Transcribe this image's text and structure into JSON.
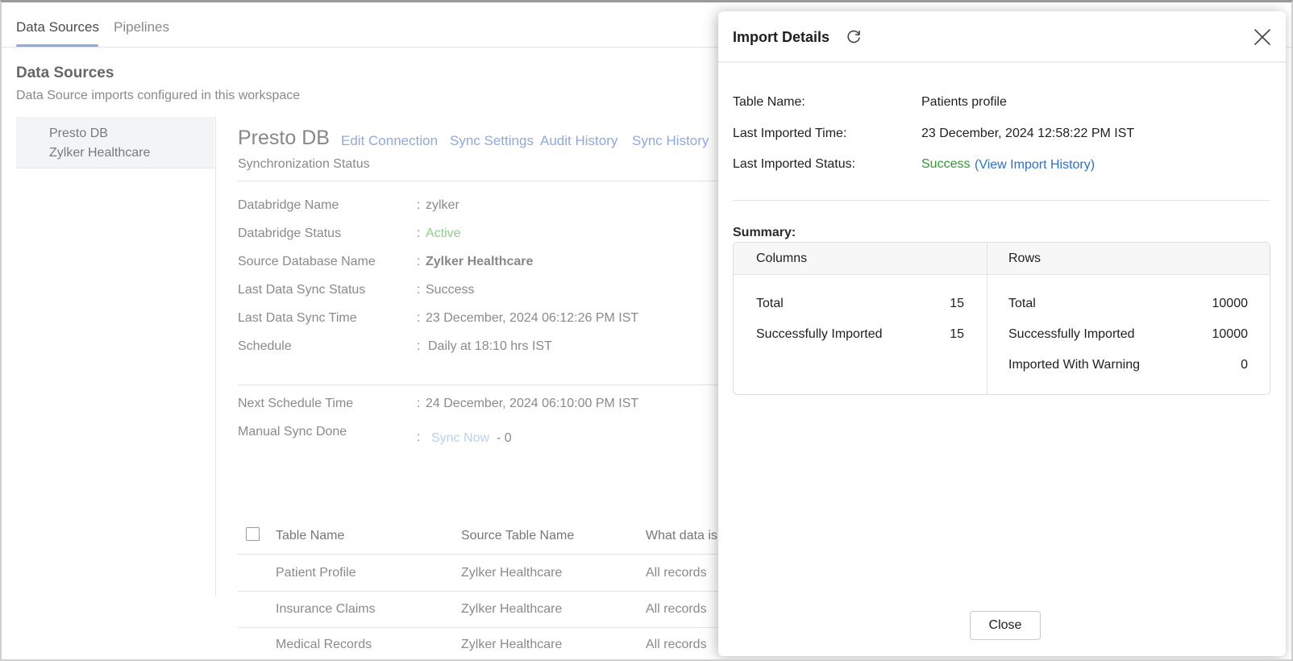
{
  "tabs": [
    {
      "label": "Data Sources"
    },
    {
      "label": "Pipelines"
    }
  ],
  "page": {
    "title": "Data Sources",
    "subtitle": "Data Source imports configured in this workspace"
  },
  "sidebar": {
    "items": [
      {
        "name": "Presto DB",
        "sub": "Zylker Healthcare"
      }
    ]
  },
  "detail": {
    "title": "Presto DB",
    "links": [
      "Edit Connection",
      "Sync Settings",
      "Audit History",
      "Sync History"
    ],
    "section": "Synchronization Status",
    "fields": [
      {
        "label": "Databridge Name",
        "value": "zylker"
      },
      {
        "label": "Databridge Status",
        "value": "Active"
      },
      {
        "label": "Source Database Name",
        "value": "Zylker Healthcare"
      },
      {
        "label": "Last Data Sync Status",
        "value": "Success"
      },
      {
        "label": "Last Data Sync Time",
        "value": "23 December, 2024 06:12:26 PM IST"
      },
      {
        "label": "Schedule",
        "value": "Daily at 18:10 hrs IST"
      },
      {
        "label": "Next Schedule Time",
        "value": "24 December, 2024 06:10:00 PM IST"
      },
      {
        "label": "Manual Sync Done",
        "value": ""
      }
    ],
    "colon": ":",
    "sync_now": "Sync Now",
    "sync_count": "- 0"
  },
  "table": {
    "headers": [
      "Table Name",
      "Source Table Name",
      "What data is"
    ],
    "rows": [
      [
        "Patient Profile",
        "Zylker Healthcare",
        "All records"
      ],
      [
        "Insurance Claims",
        "Zylker Healthcare",
        "All records"
      ],
      [
        "Medical Records",
        "Zylker Healthcare",
        "All records"
      ]
    ]
  },
  "modal": {
    "title": "Import Details",
    "fields": [
      {
        "label": "Table Name:",
        "value": "Patients profile"
      },
      {
        "label": "Last Imported Time:",
        "value": "23 December, 2024 12:58:22 PM IST"
      },
      {
        "label": "Last Imported Status:",
        "value": "Success"
      }
    ],
    "history_link": "(View Import History)",
    "summary_label": "Summary:",
    "columns": {
      "header": "Columns",
      "rows": [
        {
          "label": "Total",
          "value": "15"
        },
        {
          "label": "Successfully Imported",
          "value": "15"
        }
      ]
    },
    "rows": {
      "header": "Rows",
      "rows": [
        {
          "label": "Total",
          "value": "10000"
        },
        {
          "label": "Successfully Imported",
          "value": "10000"
        },
        {
          "label": "Imported With Warning",
          "value": "0"
        }
      ]
    },
    "close_label": "Close"
  },
  "colors": {
    "success": "#2e9b2e",
    "link": "#2c6fd9",
    "active_status": "#8fd08f",
    "tab_underline": "#8faadf"
  },
  "icons": {
    "refresh": "refresh-icon",
    "close": "close-icon"
  }
}
